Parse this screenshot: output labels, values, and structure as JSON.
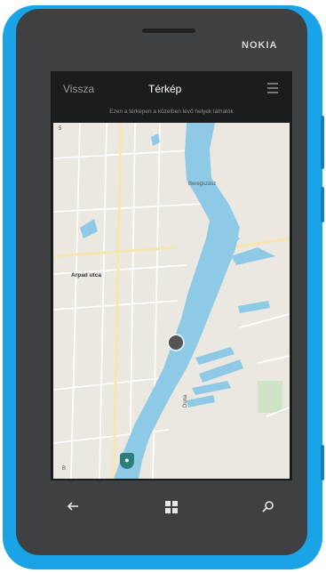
{
  "device": {
    "brand": "NOKIA"
  },
  "topbar": {
    "tabs": [
      {
        "label": "Vissza"
      },
      {
        "label": "Térkép"
      }
    ]
  },
  "subtitle": "Ezen a térképen a közelben lévő helyek láthatók",
  "map": {
    "labels": {
      "street_horizontal": "Arpad utca",
      "district_top": "Beregszász",
      "river": "Duna",
      "corner": "5",
      "watermark": "B"
    },
    "colors": {
      "water": "#8ecae6",
      "land": "#ebe8e1",
      "park": "#cfe3c7",
      "road": "#ffffff",
      "road_major": "#f6e7b0"
    }
  },
  "navbar": {
    "back_icon": "arrow-left",
    "windows_icon": "windows-logo",
    "search_icon": "search"
  }
}
